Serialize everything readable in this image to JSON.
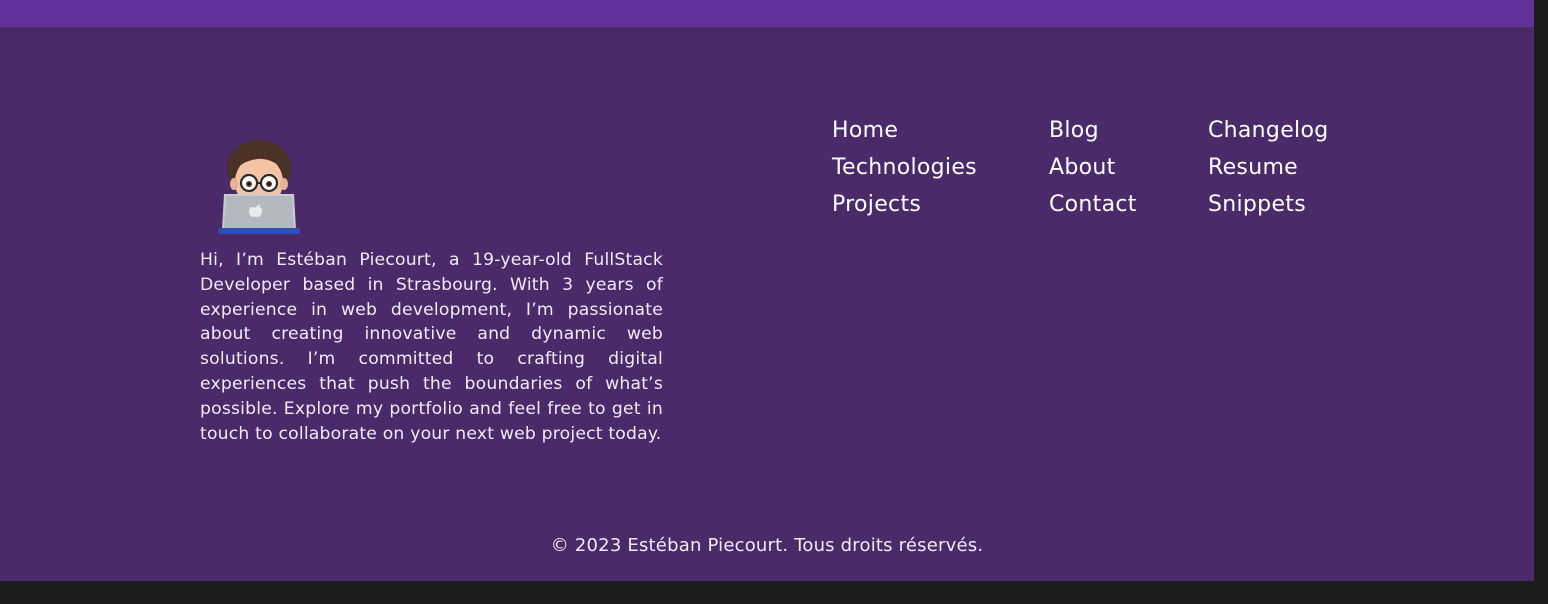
{
  "colors": {
    "accent_band": "#63319a",
    "footer_background": "#4a2a69",
    "text": "#ffffff",
    "page_background": "#1c1c1c"
  },
  "footer": {
    "avatar_icon": "memoji-developer-with-laptop",
    "bio": "Hi, I’m Estéban Piecourt, a 19-year-old FullStack Developer based in Strasbourg. With 3 years of experience in web development, I’m passionate about creating innovative and dynamic web solutions. I’m committed to crafting digital experiences that push the boundaries of what’s possible. Explore my portfolio and feel free to get in touch to collaborate on your next web project today.",
    "nav_columns": [
      [
        "Home",
        "Technologies",
        "Projects"
      ],
      [
        "Blog",
        "About",
        "Contact"
      ],
      [
        "Changelog",
        "Resume",
        "Snippets"
      ]
    ],
    "copyright": "© 2023 Estéban Piecourt. Tous droits réservés."
  }
}
